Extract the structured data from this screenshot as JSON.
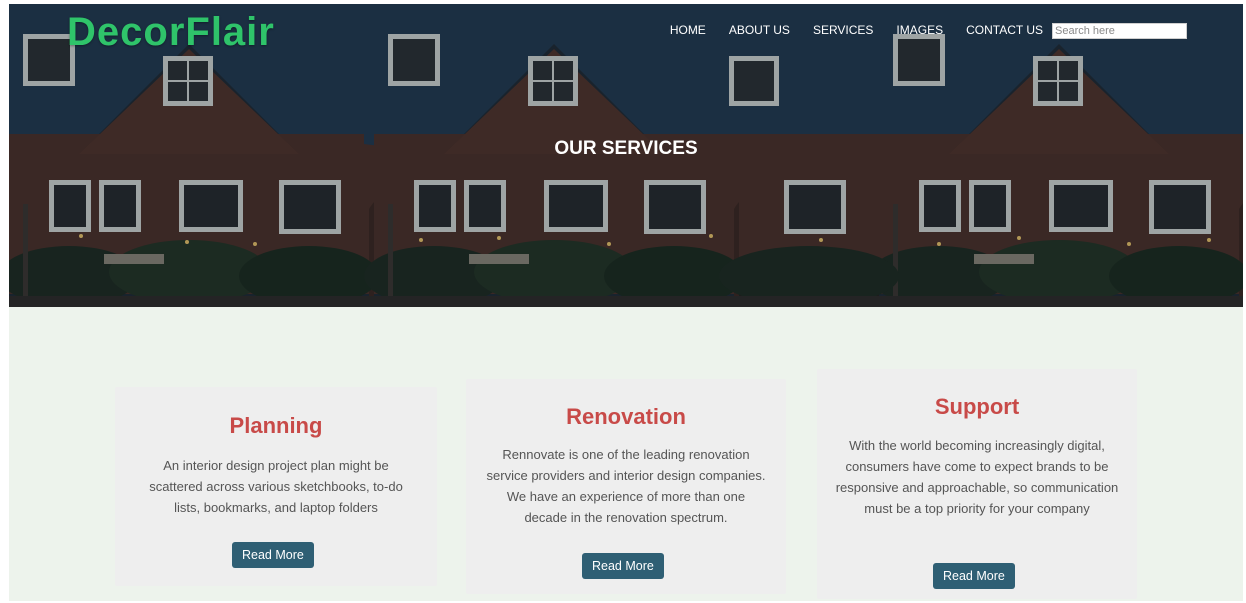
{
  "brand": {
    "logo": "DecorFlair"
  },
  "nav": {
    "items": [
      "HOME",
      "ABOUT US",
      "SERVICES",
      "IMAGES",
      "CONTACT US"
    ]
  },
  "search": {
    "placeholder": "Search here"
  },
  "hero": {
    "title": "OUR SERVICES"
  },
  "cards": [
    {
      "title": "Planning",
      "text": "An interior design project plan might be scattered across various sketchbooks, to-do lists, bookmarks, and laptop folders",
      "button": "Read More"
    },
    {
      "title": "Renovation",
      "text": "Rennovate is one of the leading renovation service providers and interior design companies. We have an experience of more than one decade in the renovation spectrum.",
      "button": "Read More"
    },
    {
      "title": "Support",
      "text": "With the world becoming increasingly digital, consumers have come to expect brands to be responsive and approachable, so communication must be a top priority for your company",
      "button": "Read More"
    }
  ],
  "colors": {
    "logo": "#2fc46a",
    "card_title": "#c84a48",
    "button": "#2f5f74",
    "section_bg": "#edf3ec",
    "card_bg": "#eeeeee"
  }
}
